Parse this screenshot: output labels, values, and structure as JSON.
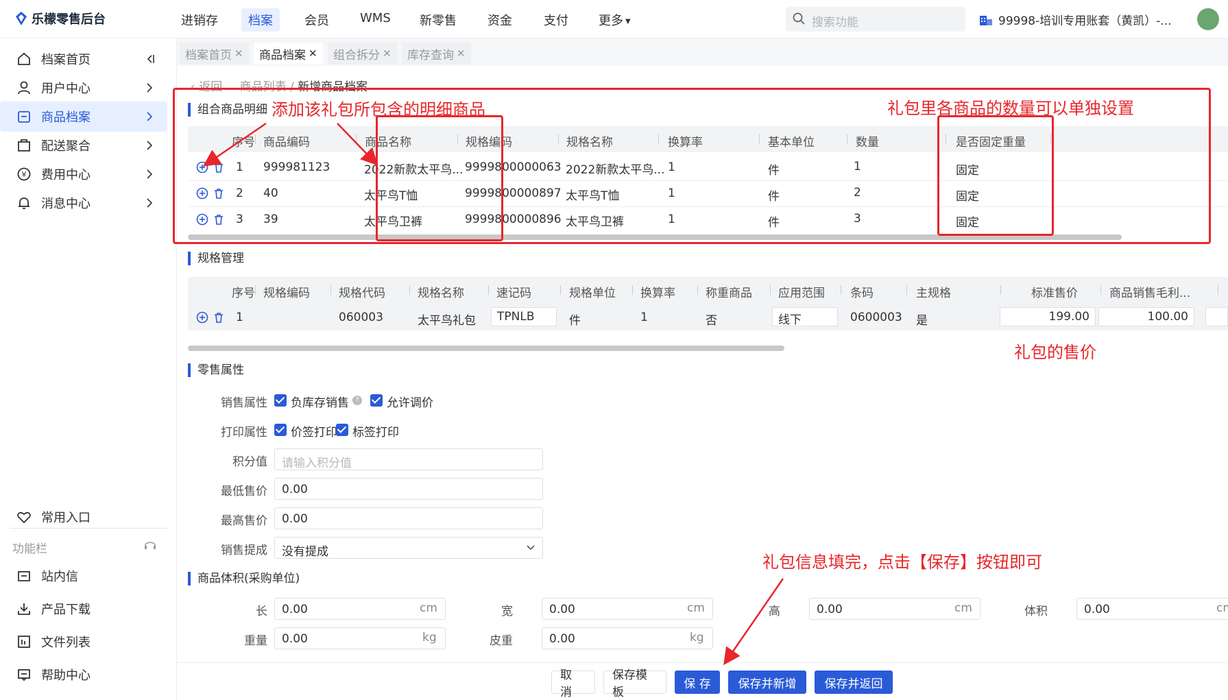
{
  "brand": {
    "name": "乐檬零售后台"
  },
  "nav": {
    "items": [
      "进销存",
      "档案",
      "会员",
      "WMS",
      "新零售",
      "资金",
      "支付",
      "更多"
    ],
    "active": "档案",
    "search_placeholder": "搜索功能",
    "account": "99998-培训专用账套（黄凯）-..."
  },
  "sidebar": {
    "items": [
      {
        "label": "档案首页",
        "icon": "home-icon"
      },
      {
        "label": "用户中心",
        "icon": "user-icon"
      },
      {
        "label": "商品档案",
        "icon": "product-icon"
      },
      {
        "label": "配送聚合",
        "icon": "delivery-icon"
      },
      {
        "label": "费用中心",
        "icon": "yen-icon"
      },
      {
        "label": "消息中心",
        "icon": "bell-icon"
      }
    ],
    "common_entry": "常用入口",
    "toolbar_section": "功能栏",
    "bottom_items": [
      "站内信",
      "产品下载",
      "文件列表",
      "帮助中心"
    ]
  },
  "tabs": [
    {
      "label": "档案首页"
    },
    {
      "label": "商品档案"
    },
    {
      "label": "组合拆分"
    },
    {
      "label": "库存查询"
    }
  ],
  "breadcrumb": {
    "back": "返回",
    "parent": "商品列表",
    "current": "新增商品档案"
  },
  "combo": {
    "title": "组合商品明细",
    "headers": [
      "序号",
      "商品编码",
      "商品名称",
      "规格编码",
      "规格名称",
      "换算率",
      "基本单位",
      "数量",
      "是否固定重量"
    ],
    "rows": [
      [
        "1",
        "999981123",
        "2022新款太平鸟...",
        "9999800000063",
        "2022新款太平鸟...",
        "1",
        "件",
        "1",
        "固定"
      ],
      [
        "2",
        "40",
        "太平鸟T恤",
        "9999800000897",
        "太平鸟T恤",
        "1",
        "件",
        "2",
        "固定"
      ],
      [
        "3",
        "39",
        "太平鸟卫裤",
        "9999800000896",
        "太平鸟卫裤",
        "1",
        "件",
        "3",
        "固定"
      ]
    ]
  },
  "spec": {
    "title": "规格管理",
    "headers": [
      "序号",
      "规格编码",
      "规格代码",
      "规格名称",
      "速记码",
      "规格单位",
      "换算率",
      "称重商品",
      "应用范围",
      "条码",
      "主规格",
      "标准售价",
      "商品销售毛利..."
    ],
    "row": [
      "1",
      "",
      "060003",
      "太平鸟礼包",
      "TPNLB",
      "件",
      "1",
      "否",
      "线下",
      "0600003",
      "是",
      "199.00",
      "100.00"
    ]
  },
  "retail": {
    "title": "零售属性",
    "sale_attr_label": "销售属性",
    "sale_opts": [
      "负库存销售",
      "允许调价"
    ],
    "print_attr_label": "打印属性",
    "print_opts": [
      "价签打印",
      "标签打印"
    ],
    "points_label": "积分值",
    "points_placeholder": "请输入积分值",
    "min_price_label": "最低售价",
    "min_price": "0.00",
    "max_price_label": "最高售价",
    "max_price": "0.00",
    "commission_label": "销售提成",
    "commission": "没有提成"
  },
  "volume": {
    "title": "商品体积(采购单位)",
    "length_label": "长",
    "length": "0.00",
    "length_unit": "cm",
    "width_label": "宽",
    "width": "0.00",
    "width_unit": "cm",
    "height_label": "高",
    "height": "0.00",
    "height_unit": "cm",
    "volume_label": "体积",
    "volume": "0.00",
    "volume_unit": "cm",
    "weight_label": "重量",
    "weight": "0.00",
    "weight_unit": "kg",
    "tare_label": "皮重",
    "tare": "0.00",
    "tare_unit": "kg"
  },
  "footer": {
    "cancel": "取 消",
    "save_template": "保存模板",
    "save": "保 存",
    "save_new": "保存并新增",
    "save_back": "保存并返回"
  },
  "annotations": {
    "add_items": "添加该礼包所包含的明细商品",
    "qty_note": "礼包里各商品的数量可以单独设置",
    "price_note": "礼包的售价",
    "save_note": "礼包信息填完，点击【保存】按钮即可"
  },
  "colors": {
    "accent": "#2a5bd7",
    "annotation": "#e8262b"
  }
}
